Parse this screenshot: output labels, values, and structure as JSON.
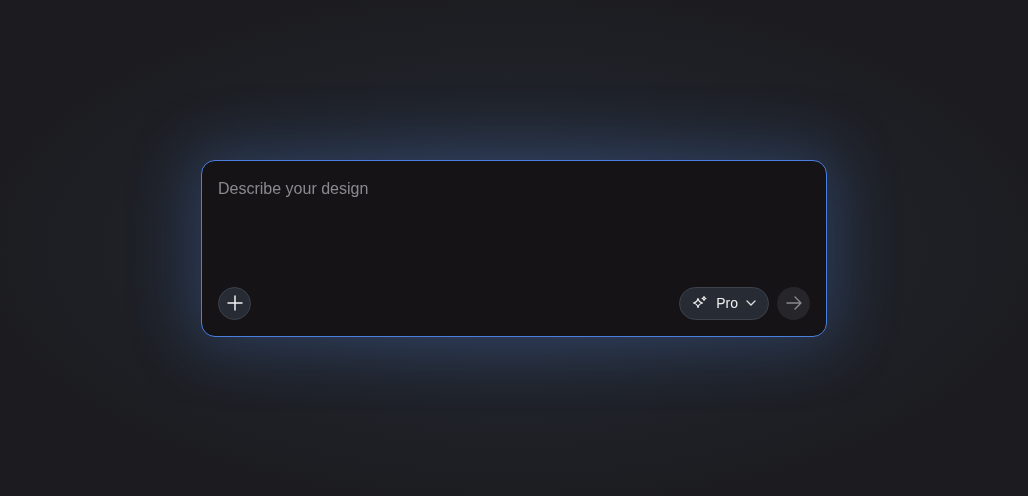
{
  "prompt": {
    "placeholder": "Describe your design"
  },
  "model_picker": {
    "label": "Pro"
  },
  "submit": {
    "disabled": true
  }
}
